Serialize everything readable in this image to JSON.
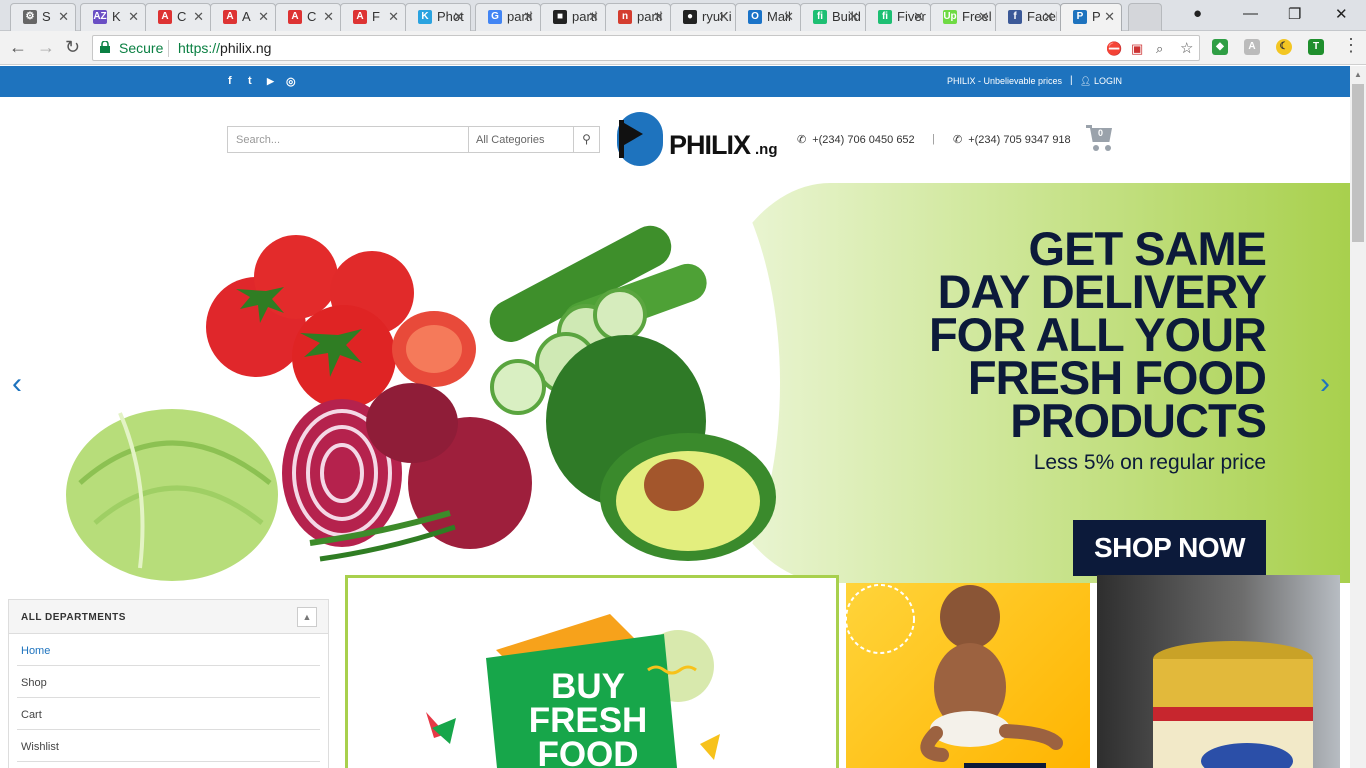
{
  "browser": {
    "tabs": [
      {
        "title": "S",
        "icon": "gear-icon",
        "color": "#666666",
        "glyph": "⚙"
      },
      {
        "title": "K",
        "icon": "az-icon",
        "color": "#6a4fc4",
        "glyph": "AZ"
      },
      {
        "title": "C",
        "icon": "angular-icon",
        "color": "#dd3333",
        "glyph": "A"
      },
      {
        "title": "A",
        "icon": "angular-icon",
        "color": "#dd3333",
        "glyph": "A"
      },
      {
        "title": "C",
        "icon": "angular-icon",
        "color": "#dd3333",
        "glyph": "A"
      },
      {
        "title": "F",
        "icon": "angular-icon",
        "color": "#dd3333",
        "glyph": "A"
      },
      {
        "title": "Phot",
        "icon": "photo-icon",
        "color": "#2aa3e0",
        "glyph": "K"
      },
      {
        "title": "parti",
        "icon": "google-icon",
        "color": "#4285f4",
        "glyph": "G"
      },
      {
        "title": "parti",
        "icon": "black-square-icon",
        "color": "#222222",
        "glyph": "■"
      },
      {
        "title": "parti",
        "icon": "n-icon",
        "color": "#d43d2f",
        "glyph": "n"
      },
      {
        "title": "ryuKi",
        "icon": "github-icon",
        "color": "#222222",
        "glyph": "●"
      },
      {
        "title": "Mail",
        "icon": "outlook-icon",
        "color": "#1a73c8",
        "glyph": "O"
      },
      {
        "title": "Build",
        "icon": "fiverr-icon",
        "color": "#1dbf73",
        "glyph": "fi"
      },
      {
        "title": "Fiver",
        "icon": "fiverr-icon",
        "color": "#1dbf73",
        "glyph": "fi"
      },
      {
        "title": "Freel",
        "icon": "upwork-icon",
        "color": "#6fda44",
        "glyph": "Up"
      },
      {
        "title": "Facel",
        "icon": "facebook-icon",
        "color": "#3b5998",
        "glyph": "f"
      },
      {
        "title": "P",
        "icon": "philix-icon",
        "color": "#1e73be",
        "glyph": "P"
      }
    ],
    "secure_label": "Secure",
    "url_scheme": "https://",
    "url_host": "philix.ng"
  },
  "topbar": {
    "tagline": "PHILIX - Unbelievable prices",
    "divider": "|",
    "login": "LOGIN",
    "social": [
      "f",
      "t",
      "▶",
      "◎"
    ]
  },
  "header": {
    "search_placeholder": "Search...",
    "category_label": "All Categories",
    "logo_text": "PHILIX",
    "logo_tld": ".ng",
    "phone1": "+(234) 706 0450 652",
    "phone_divider": "|",
    "phone2": "+(234) 705 9347 918",
    "cart_count": "0"
  },
  "hero": {
    "headline": [
      "GET SAME",
      "DAY DELIVERY",
      "FOR ALL YOUR",
      "FRESH FOOD",
      "PRODUCTS"
    ],
    "subline": "Less 5% on regular price",
    "cta": "SHOP NOW",
    "prev_glyph": "‹",
    "next_glyph": "›"
  },
  "departments": {
    "title": "ALL DEPARTMENTS",
    "items": [
      "Home",
      "Shop",
      "Cart",
      "Wishlist"
    ]
  },
  "promos": {
    "buy_fresh": [
      "BUY",
      "FRESH",
      "FOOD"
    ]
  },
  "colors": {
    "brand_blue": "#1e73be",
    "hero_green": "#a8d04d",
    "headline_navy": "#0c1a3a"
  }
}
